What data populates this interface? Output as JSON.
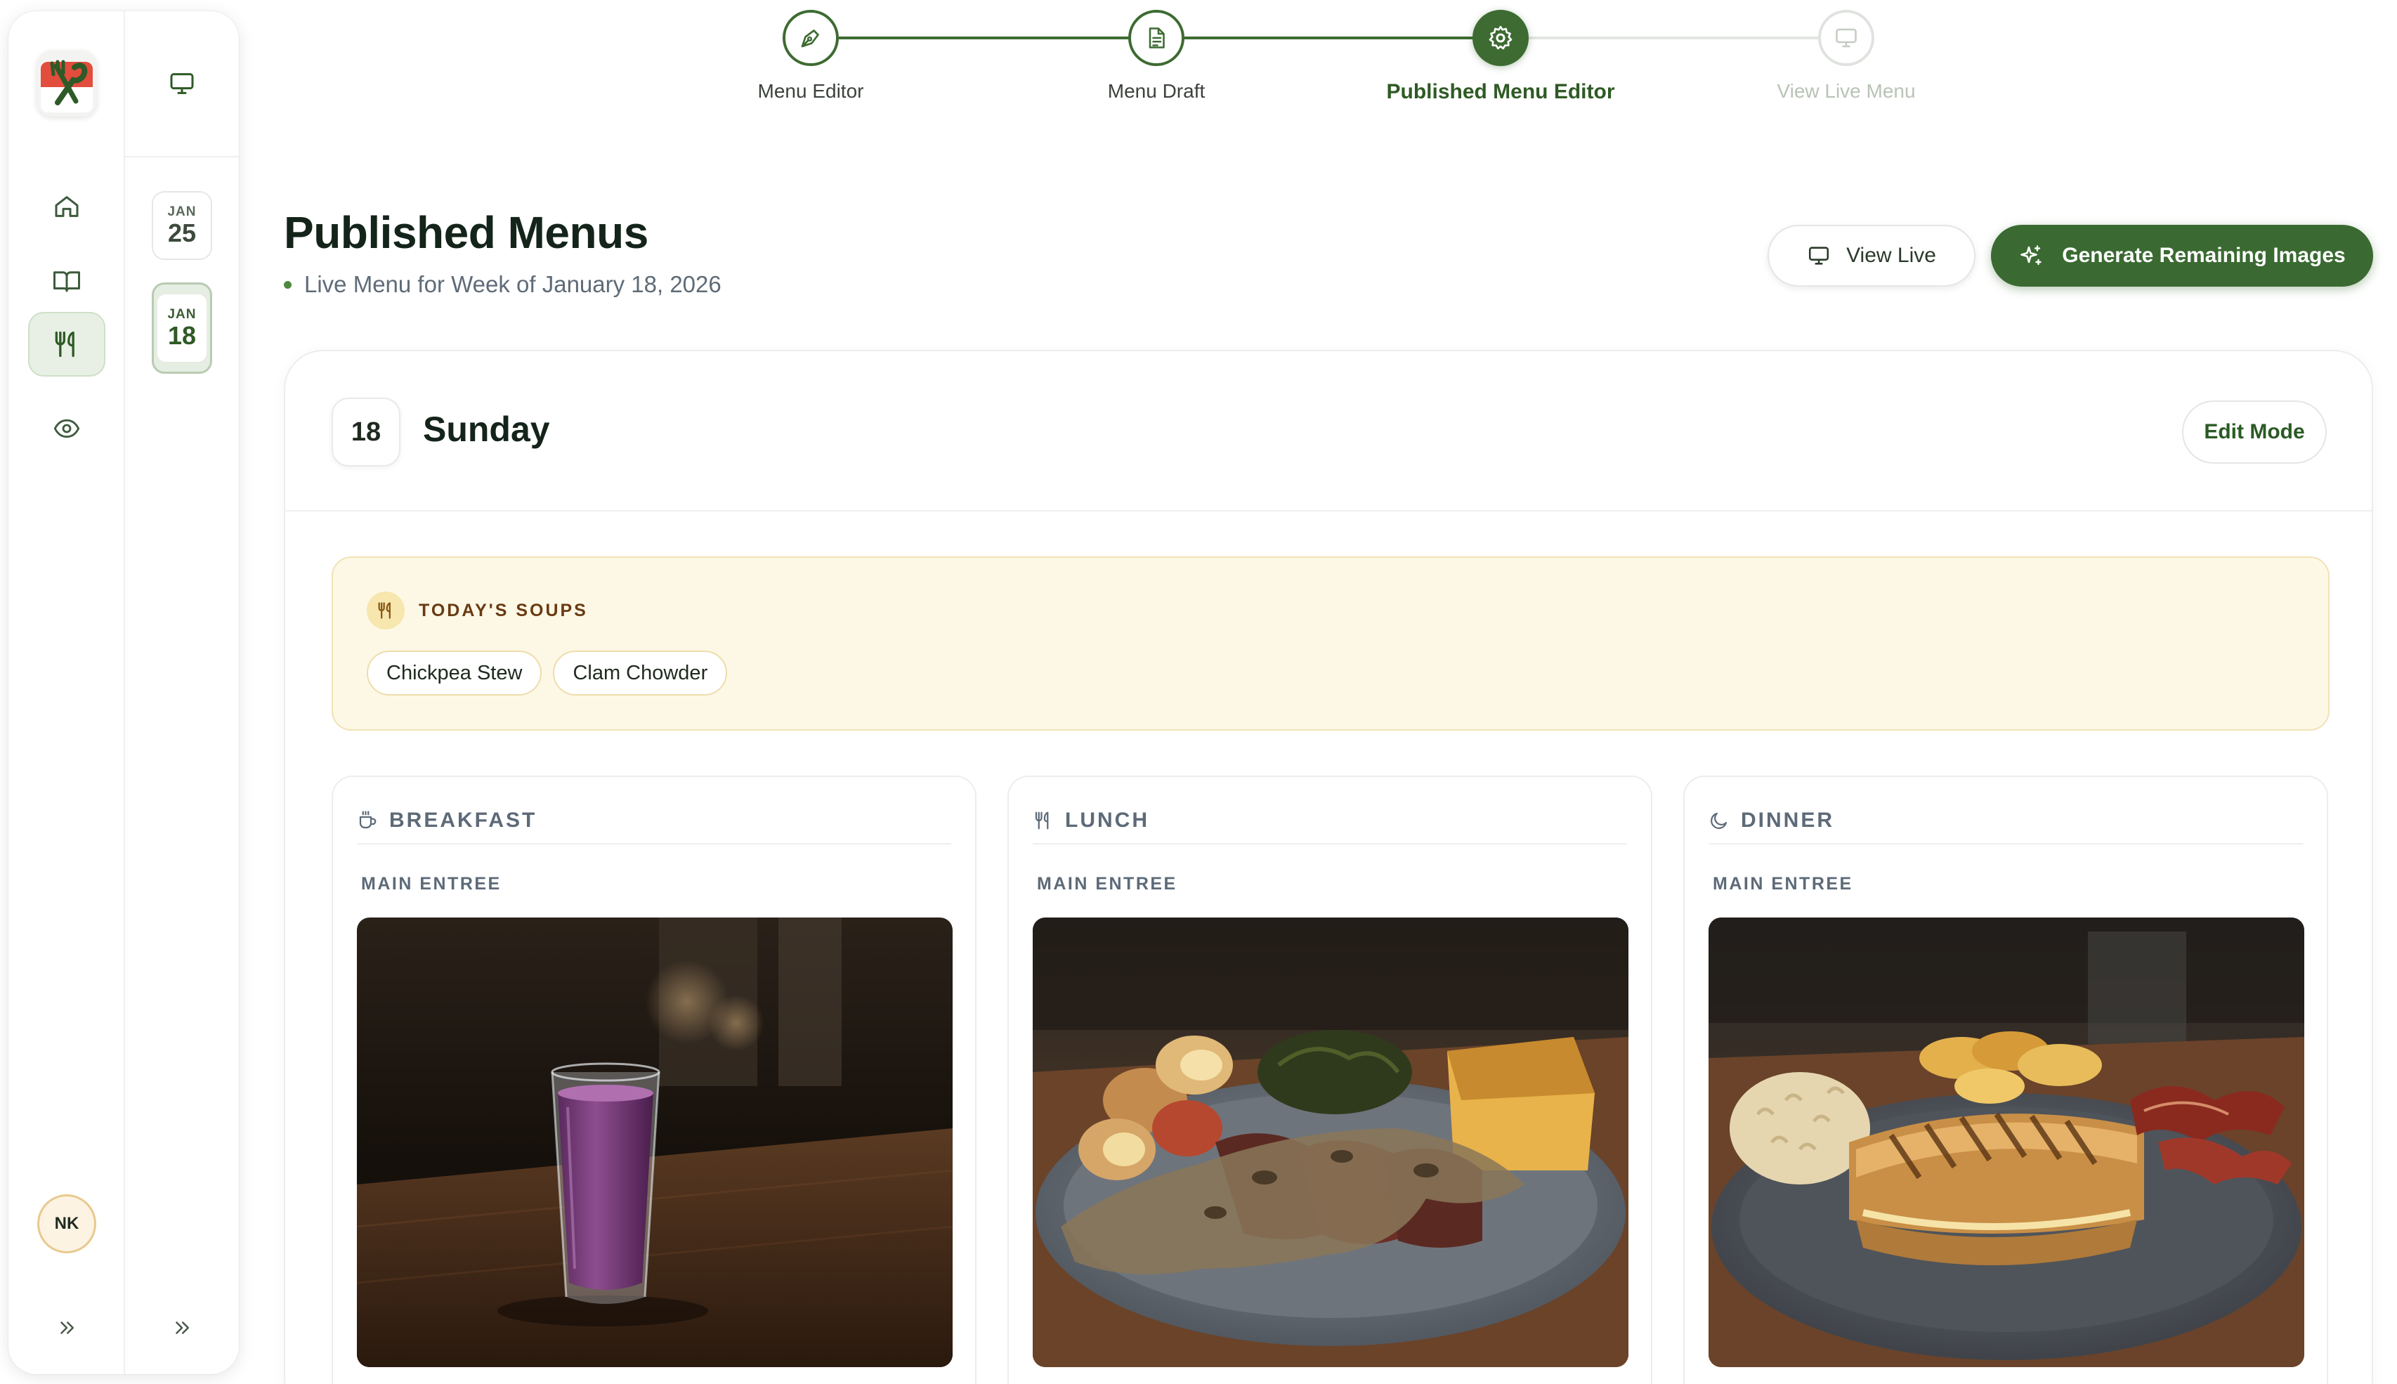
{
  "sidebar": {
    "avatar_initials": "NK",
    "dates": [
      {
        "month": "JAN",
        "day": "25"
      },
      {
        "month": "JAN",
        "day": "18"
      }
    ]
  },
  "stepper": {
    "steps": [
      {
        "label": "Menu Editor",
        "state": "done"
      },
      {
        "label": "Menu Draft",
        "state": "done"
      },
      {
        "label": "Published Menu Editor",
        "state": "current"
      },
      {
        "label": "View Live Menu",
        "state": "todo"
      }
    ]
  },
  "header": {
    "title": "Published Menus",
    "subtitle": "Live Menu for Week of January 18, 2026",
    "view_live_label": "View Live",
    "generate_label": "Generate Remaining Images"
  },
  "day": {
    "number": "18",
    "name": "Sunday",
    "edit_label": "Edit Mode"
  },
  "soups": {
    "title": "TODAY'S SOUPS",
    "items": [
      "Chickpea Stew",
      "Clam Chowder"
    ]
  },
  "meals": [
    {
      "title": "BREAKFAST",
      "section": "MAIN ENTREE",
      "icon": "coffee-cup-icon"
    },
    {
      "title": "LUNCH",
      "section": "MAIN ENTREE",
      "icon": "utensils-icon"
    },
    {
      "title": "DINNER",
      "section": "MAIN ENTREE",
      "icon": "moon-icon"
    }
  ],
  "colors": {
    "brand_green": "#3a6a31",
    "soups_bg": "#fdf8e6",
    "soups_text": "#6a3a12"
  }
}
